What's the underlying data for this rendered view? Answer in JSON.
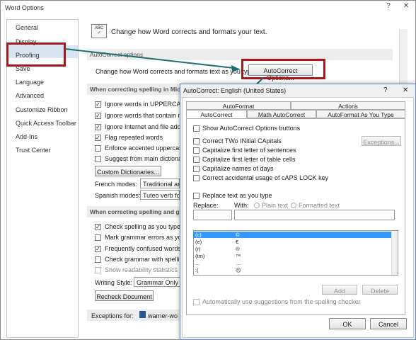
{
  "window": {
    "title": "Word Options",
    "help": "?",
    "close": "✕"
  },
  "nav": {
    "items": [
      "General",
      "Display",
      "Proofing",
      "Save",
      "Language",
      "Advanced",
      "Customize Ribbon",
      "Quick Access Toolbar",
      "Add-Ins",
      "Trust Center"
    ]
  },
  "header": {
    "text": "Change how Word corrects and formats your text."
  },
  "autocorrect": {
    "section": "AutoCorrect options",
    "desc": "Change how Word corrects and formats text as you type:",
    "button": "AutoCorrect Options..."
  },
  "spelling": {
    "section": "When correcting spelling in Micr",
    "options": [
      "Ignore words in UPPERCASE",
      "Ignore words that contain nu",
      "Ignore Internet and file addre",
      "Flag repeated words",
      "Enforce accented uppercase",
      "Suggest from main dictionar"
    ],
    "custom_dict_btn": "Custom Dictionaries...",
    "french_label": "French modes:",
    "french_value": "Traditional an",
    "spanish_label": "Spanish modes:",
    "spanish_value": "Tuteo verb fo"
  },
  "grammar": {
    "section": "When correcting spelling and gr",
    "options": [
      "Check spelling as you type",
      "Mark grammar errors as you",
      "Frequently confused words",
      "Check grammar with spellin",
      "Show readability statistics"
    ],
    "writing_style_label": "Writing Style:",
    "writing_style_value": "Grammar Only",
    "recheck_btn": "Recheck Document"
  },
  "exceptions": {
    "label": "Exceptions for:",
    "value": "warner-wo"
  },
  "dialog": {
    "title": "AutoCorrect: English (United States)",
    "help": "?",
    "close": "✕",
    "tabs_row1": [
      "AutoFormat",
      "Actions"
    ],
    "tabs_row2": [
      "AutoCorrect",
      "Math AutoCorrect",
      "AutoFormat As You Type"
    ],
    "show_buttons": "Show AutoCorrect Options buttons",
    "options": [
      "Correct TWo INitial CApitals",
      "Capitalize first letter of sentences",
      "Capitalize first letter of table cells",
      "Capitalize names of days",
      "Correct accidental usage of cAPS LOCK key"
    ],
    "exceptions_btn": "Exceptions...",
    "replace_as_type": "Replace text as you type",
    "replace_label": "Replace:",
    "with_label": "With:",
    "plain_text": "Plain text",
    "formatted_text": "Formatted text",
    "rows": [
      [
        "(c)",
        "©"
      ],
      [
        "(e)",
        "€"
      ],
      [
        "(r)",
        "®"
      ],
      [
        "(tm)",
        "™"
      ],
      [
        "...",
        "…"
      ],
      [
        ":(",
        "☹"
      ]
    ],
    "add_btn": "Add",
    "delete_btn": "Delete",
    "auto_suggest": "Automatically use suggestions from the spelling checker",
    "ok": "OK",
    "cancel": "Cancel"
  }
}
